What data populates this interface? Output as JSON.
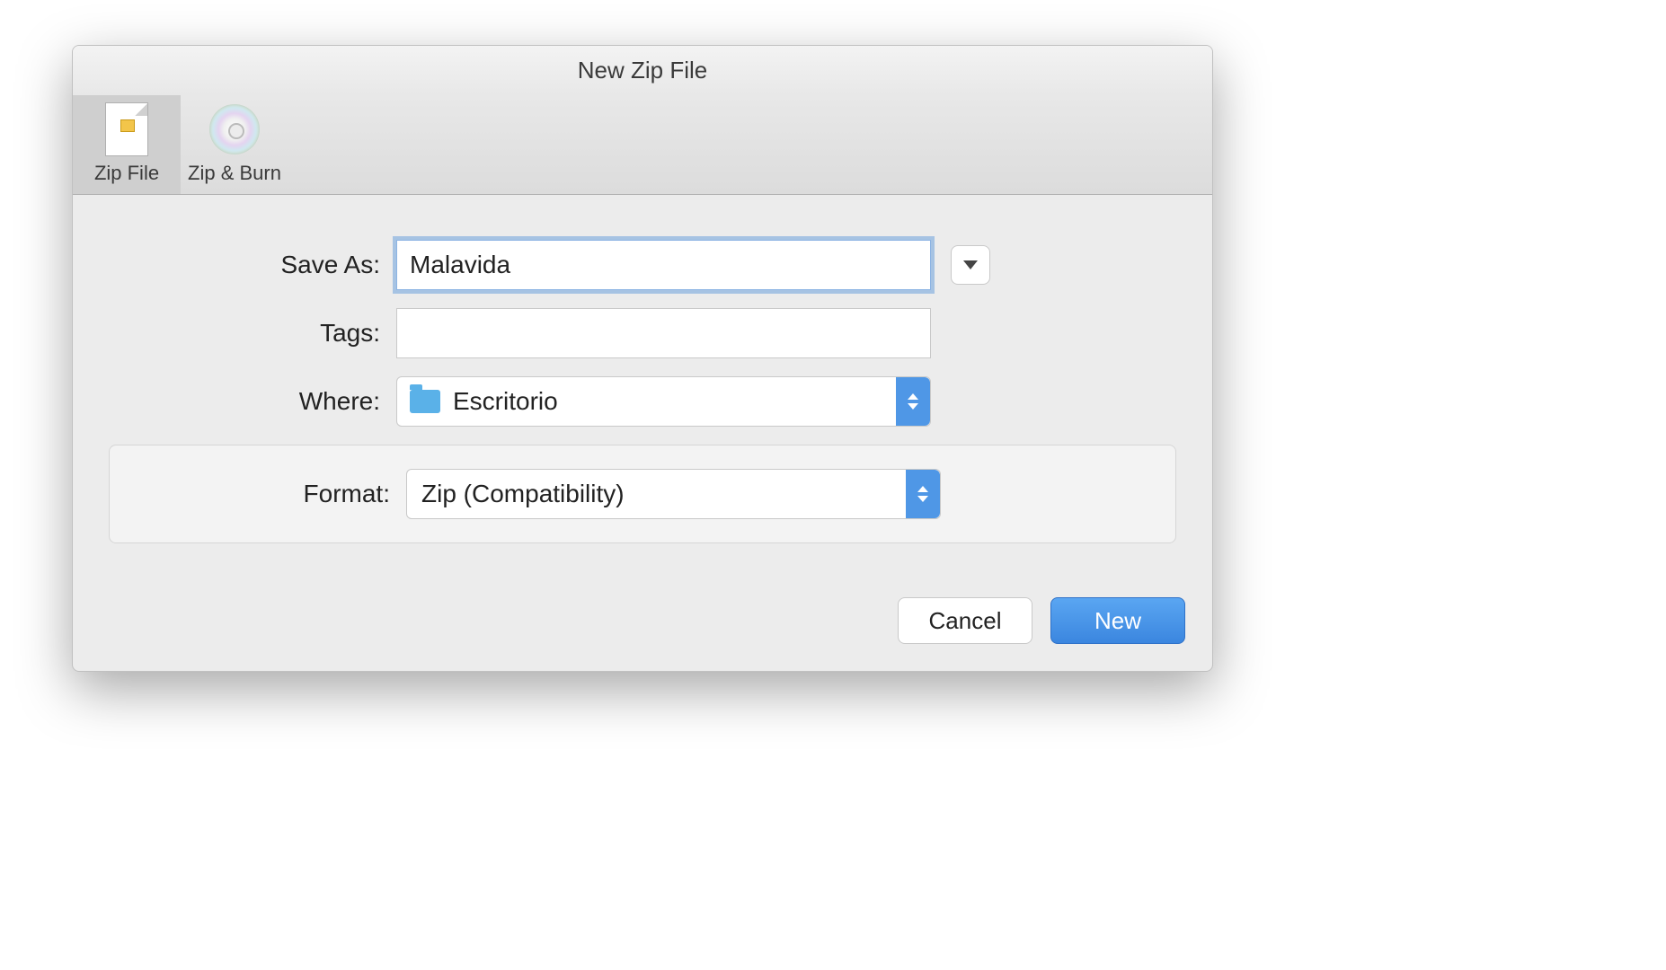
{
  "dialog": {
    "title": "New Zip File"
  },
  "toolbar": {
    "items": [
      {
        "label": "Zip File"
      },
      {
        "label": "Zip & Burn"
      }
    ]
  },
  "form": {
    "save_as_label": "Save As:",
    "save_as_value": "Malavida",
    "tags_label": "Tags:",
    "tags_value": "",
    "where_label": "Where:",
    "where_value": "Escritorio",
    "format_label": "Format:",
    "format_value": "Zip (Compatibility)"
  },
  "buttons": {
    "cancel": "Cancel",
    "new": "New"
  }
}
